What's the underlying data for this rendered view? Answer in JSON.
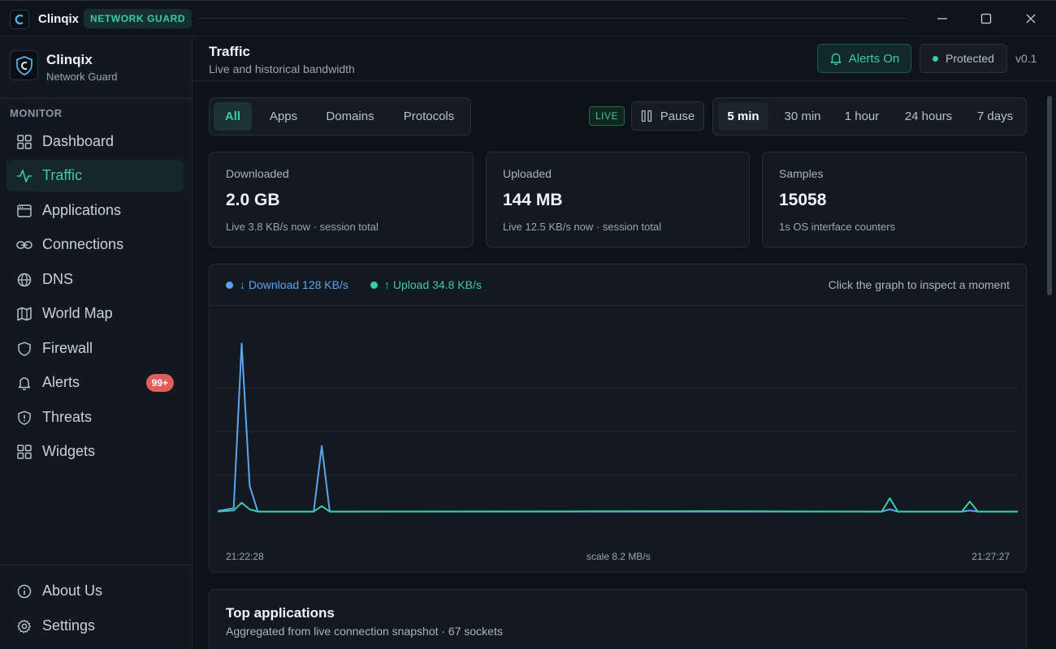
{
  "titlebar": {
    "app_name": "Clinqix",
    "badge": "NETWORK GUARD"
  },
  "brand": {
    "name": "Clinqix",
    "subtitle": "Network Guard"
  },
  "sidebar": {
    "section_label": "MONITOR",
    "items": [
      {
        "label": "Dashboard",
        "icon": "grid-icon"
      },
      {
        "label": "Traffic",
        "icon": "activity-icon",
        "active": true
      },
      {
        "label": "Applications",
        "icon": "window-icon"
      },
      {
        "label": "Connections",
        "icon": "link-icon"
      },
      {
        "label": "DNS",
        "icon": "globe-icon"
      },
      {
        "label": "World Map",
        "icon": "map-icon"
      },
      {
        "label": "Firewall",
        "icon": "shield-icon"
      },
      {
        "label": "Alerts",
        "icon": "bell-icon",
        "badge": "99+"
      },
      {
        "label": "Threats",
        "icon": "shield-alert-icon"
      },
      {
        "label": "Widgets",
        "icon": "widgets-icon"
      }
    ],
    "footer": [
      {
        "label": "About Us",
        "icon": "info-icon"
      },
      {
        "label": "Settings",
        "icon": "gear-icon"
      }
    ]
  },
  "header": {
    "title": "Traffic",
    "subtitle": "Live and historical bandwidth",
    "alerts_label": "Alerts On",
    "status_label": "Protected",
    "version": "v0.1"
  },
  "filters": [
    "All",
    "Apps",
    "Domains",
    "Protocols"
  ],
  "live_label": "LIVE",
  "pause_label": "Pause",
  "ranges": [
    "5 min",
    "30 min",
    "1 hour",
    "24 hours",
    "7 days"
  ],
  "stats": [
    {
      "label": "Downloaded",
      "value": "2.0 GB",
      "note": "Live 3.8 KB/s now · session total"
    },
    {
      "label": "Uploaded",
      "value": "144 MB",
      "note": "Live 12.5 KB/s now · session total"
    },
    {
      "label": "Samples",
      "value": "15058",
      "note": "1s OS interface counters"
    }
  ],
  "chart": {
    "download_legend": "↓ Download 128 KB/s",
    "upload_legend": "↑ Upload 34.8 KB/s",
    "hint": "Click the graph to inspect a moment",
    "start_time": "21:22:28",
    "scale_label": "scale 8.2 MB/s",
    "end_time": "21:27:27"
  },
  "chart_data": {
    "type": "line",
    "x_start": "21:22:28",
    "x_end": "21:27:27",
    "y_max_mb_s": 8.2,
    "series": [
      {
        "name": "Download",
        "color": "#5fa3f0",
        "points": [
          [
            0,
            0.08
          ],
          [
            2,
            0.2
          ],
          [
            3,
            7.6
          ],
          [
            4,
            1.2
          ],
          [
            5,
            0.05
          ],
          [
            12,
            0.05
          ],
          [
            13,
            3.0
          ],
          [
            14,
            0.05
          ],
          [
            40,
            0.05
          ],
          [
            83,
            0.05
          ],
          [
            84,
            0.15
          ],
          [
            85,
            0.05
          ],
          [
            93,
            0.05
          ],
          [
            94,
            0.1
          ],
          [
            95,
            0.05
          ],
          [
            100,
            0.05
          ]
        ]
      },
      {
        "name": "Upload",
        "color": "#3ec9a7",
        "points": [
          [
            0,
            0.05
          ],
          [
            2,
            0.1
          ],
          [
            3,
            0.45
          ],
          [
            4,
            0.15
          ],
          [
            5,
            0.05
          ],
          [
            12,
            0.05
          ],
          [
            13,
            0.3
          ],
          [
            14,
            0.05
          ],
          [
            60,
            0.07
          ],
          [
            83,
            0.05
          ],
          [
            84,
            0.65
          ],
          [
            85,
            0.05
          ],
          [
            93,
            0.05
          ],
          [
            94,
            0.5
          ],
          [
            95,
            0.05
          ],
          [
            100,
            0.05
          ]
        ]
      }
    ]
  },
  "apps": {
    "title": "Top applications",
    "subtitle": "Aggregated from live connection snapshot · 67 sockets"
  },
  "colors": {
    "accent": "#3ec9a7",
    "download": "#5fa3f0",
    "danger": "#e25c5c"
  }
}
